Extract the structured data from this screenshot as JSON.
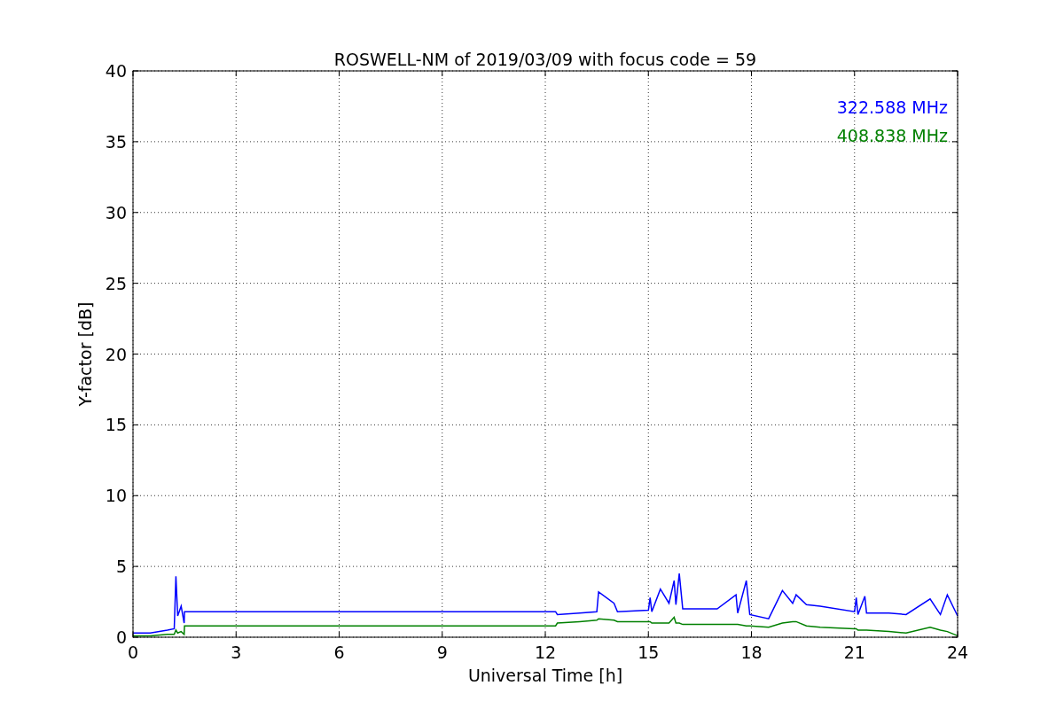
{
  "chart_data": {
    "type": "line",
    "title": "ROSWELL-NM of 2019/03/09 with focus code = 59",
    "xlabel": "Universal Time [h]",
    "ylabel": "Y-factor [dB]",
    "xlim": [
      0,
      24
    ],
    "ylim": [
      0,
      40
    ],
    "xticks": [
      0,
      3,
      6,
      9,
      12,
      15,
      18,
      21,
      24
    ],
    "yticks": [
      0,
      5,
      10,
      15,
      20,
      25,
      30,
      35,
      40
    ],
    "grid": true,
    "x": [
      0,
      0.5,
      1.0,
      1.2,
      1.25,
      1.3,
      1.4,
      1.49,
      1.5,
      12.3,
      12.35,
      13,
      13.5,
      13.55,
      14,
      14.1,
      15,
      15.05,
      15.1,
      15.35,
      15.6,
      15.75,
      15.8,
      15.9,
      16,
      17,
      17.55,
      17.6,
      17.85,
      17.95,
      18.5,
      18.9,
      19.2,
      19.3,
      19.6,
      20,
      21,
      21.05,
      21.1,
      21.3,
      21.35,
      22,
      22.5,
      23.2,
      23.5,
      23.7,
      24
    ],
    "series": [
      {
        "name": "322.588 MHz",
        "color": "#0000ff",
        "values": [
          0.3,
          0.3,
          0.5,
          0.6,
          4.3,
          1.5,
          2.2,
          1.0,
          1.8,
          1.8,
          1.6,
          1.7,
          1.8,
          3.2,
          2.4,
          1.8,
          1.9,
          2.8,
          1.8,
          3.4,
          2.4,
          4.0,
          2.3,
          4.5,
          2.0,
          2.0,
          3.0,
          1.7,
          4.0,
          1.6,
          1.3,
          3.3,
          2.4,
          3.0,
          2.3,
          2.2,
          1.8,
          2.8,
          1.6,
          2.9,
          1.7,
          1.7,
          1.6,
          2.7,
          1.6,
          3.0,
          1.5
        ]
      },
      {
        "name": "408.838 MHz",
        "color": "#008000",
        "values": [
          0.1,
          0.1,
          0.2,
          0.2,
          0.5,
          0.3,
          0.4,
          0.2,
          0.8,
          0.8,
          1.0,
          1.1,
          1.2,
          1.3,
          1.2,
          1.1,
          1.1,
          1.1,
          1.0,
          1.0,
          1.0,
          1.4,
          1.0,
          1.0,
          0.9,
          0.9,
          0.9,
          0.9,
          0.8,
          0.8,
          0.7,
          1.0,
          1.1,
          1.1,
          0.8,
          0.7,
          0.6,
          0.6,
          0.5,
          0.5,
          0.5,
          0.4,
          0.3,
          0.7,
          0.5,
          0.4,
          0.1
        ]
      }
    ]
  }
}
